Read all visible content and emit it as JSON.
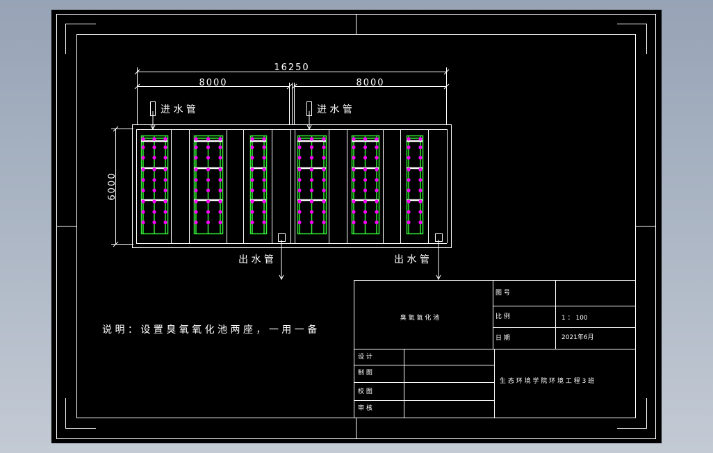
{
  "colors": {
    "background": "#000000",
    "line": "#ffffff",
    "pipe": "#33ee33",
    "diffuser": "#ff00ff",
    "beam": "#ffffff"
  },
  "dimensions": {
    "overall": "16250",
    "left_half": "8000",
    "right_half": "8000",
    "height": "6000"
  },
  "labels": {
    "inlet_left": "进 水 管",
    "inlet_right": "进 水 管",
    "outlet_left": "出 水 管",
    "outlet_right": "出 水 管"
  },
  "note": "说 明 ： 设 置 臭 氧 氧 化 池 两 座 ， 一 用 一 备",
  "title_block": {
    "drawing_name": "臭 氧 氧 化 池",
    "drawing_no_label": "图    号",
    "drawing_no_value": "",
    "scale_label": "比    例",
    "scale_value": "1 ： 100",
    "date_label": "日    期",
    "date_value": "2021年6月",
    "designer_label": "设    计",
    "drafter_label": "制    图",
    "checker_label": "校    图",
    "reviewer_label": "审    核",
    "institution": "生 态 环 境 学 院 环 境 工 程 3 班"
  }
}
